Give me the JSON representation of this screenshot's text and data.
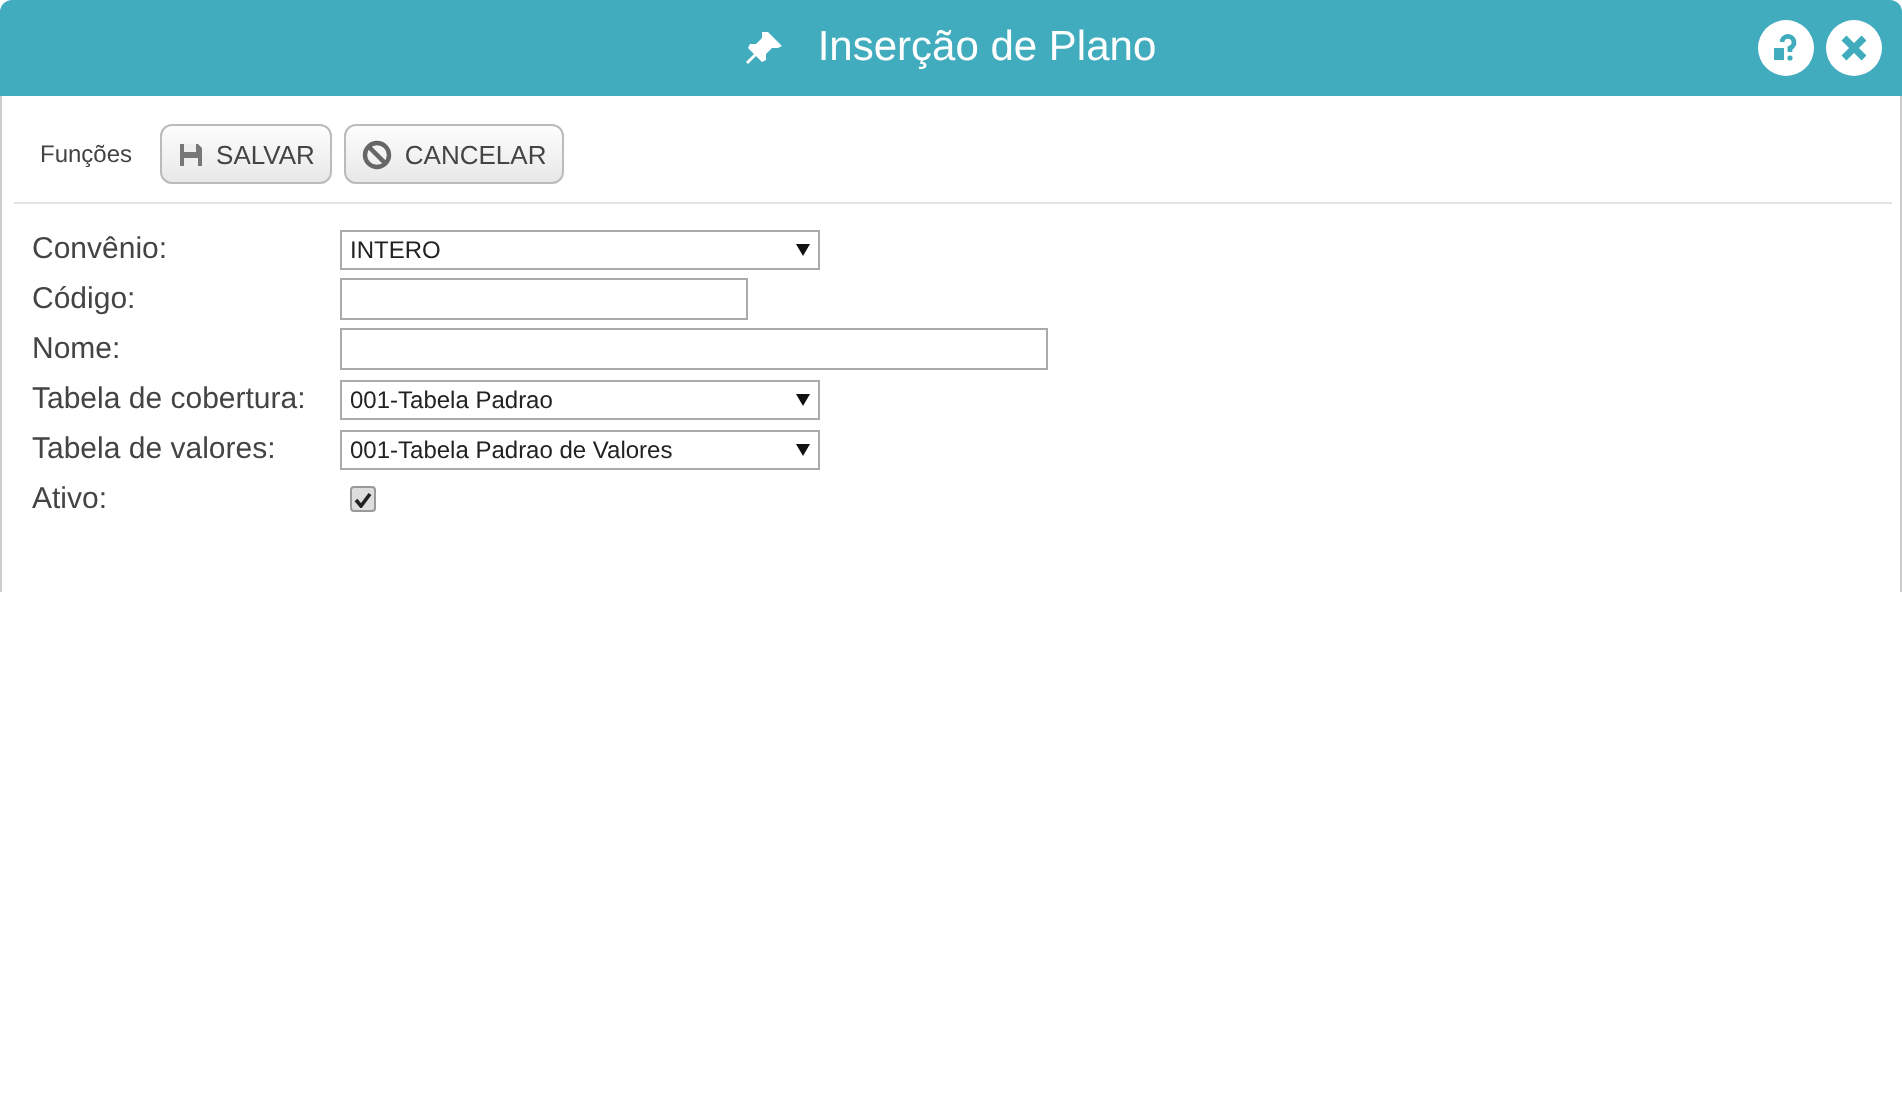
{
  "window": {
    "title": "Inserção de Plano"
  },
  "toolbar": {
    "label": "Funções",
    "buttons": [
      {
        "label": "SALVAR",
        "kind": "save"
      },
      {
        "label": "CANCELAR",
        "kind": "cancel"
      }
    ]
  },
  "fields": [
    {
      "label": "Convênio:",
      "kind": "select",
      "value": "INTERO"
    },
    {
      "label": "Código:",
      "kind": "text"
    },
    {
      "label": "Nome:",
      "kind": "text"
    },
    {
      "label": "Tabela de cobertura:",
      "kind": "select",
      "value": "001-Tabela Padrao"
    },
    {
      "label": "Tabela de valores:",
      "kind": "select",
      "value": "001-Tabela Padrao de Valores"
    },
    {
      "label": "Ativo:",
      "kind": "checkbox",
      "checked": true
    }
  ]
}
